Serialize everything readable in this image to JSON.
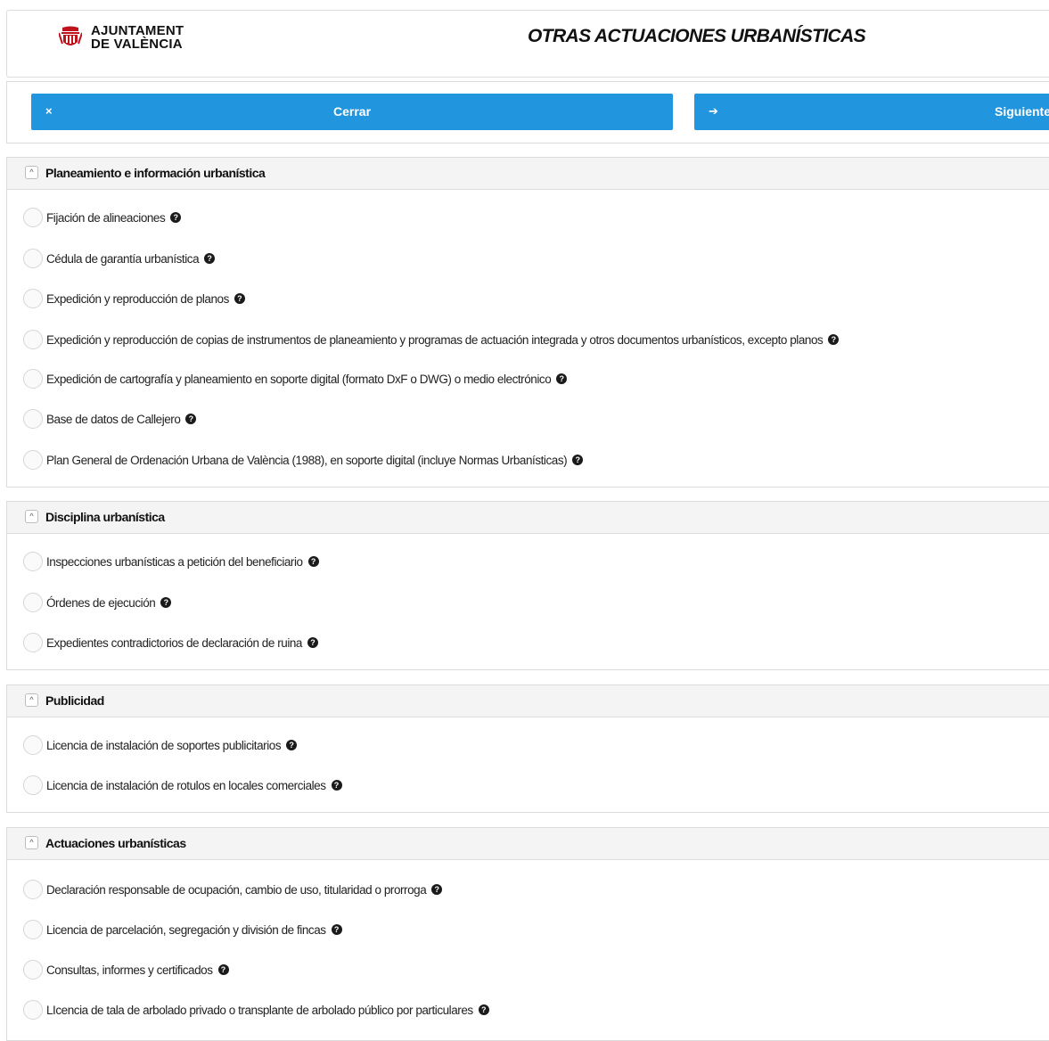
{
  "header": {
    "logo_line1": "AJUNTAMENT",
    "logo_line2": "DE VALÈNCIA",
    "title": "OTRAS ACTUACIONES URBANÍSTICAS"
  },
  "toolbar": {
    "close_icon": "×",
    "close_label": "Cerrar",
    "next_icon": "➔",
    "next_label": "Siguiente"
  },
  "icons": {
    "toggle": "^",
    "help": "?"
  },
  "sections": [
    {
      "title": "Planeamiento e información urbanística",
      "options": [
        "Fijación de alineaciones",
        "Cédula de garantía urbanística",
        "Expedición y reproducción de planos",
        "Expedición y reproducción de copias de instrumentos de planeamiento y programas de actuación integrada y otros documentos urbanísticos, excepto planos",
        "Expedición de cartografía y planeamiento en soporte digital (formato DxF o DWG) o medio electrónico",
        "Base de datos de Callejero",
        "Plan General de Ordenación Urbana de València (1988), en soporte digital (incluye Normas Urbanísticas)"
      ]
    },
    {
      "title": "Disciplina urbanística",
      "options": [
        "Inspecciones urbanísticas a petición del beneficiario",
        "Órdenes de ejecución",
        "Expedientes contradictorios de declaración de ruina"
      ]
    },
    {
      "title": "Publicidad",
      "options": [
        "Licencia de instalación de soportes publicitarios",
        "Licencia de instalación de rotulos en locales comerciales"
      ]
    },
    {
      "title": "Actuaciones urbanísticas",
      "options": [
        "Declaración responsable de ocupación, cambio de uso, titularidad o prorroga",
        "Licencia de parcelación, segregación y división de fincas",
        "Consultas, informes y certificados",
        "LIcencia de tala de arbolado privado o transplante de arbolado público por particulares"
      ]
    }
  ]
}
